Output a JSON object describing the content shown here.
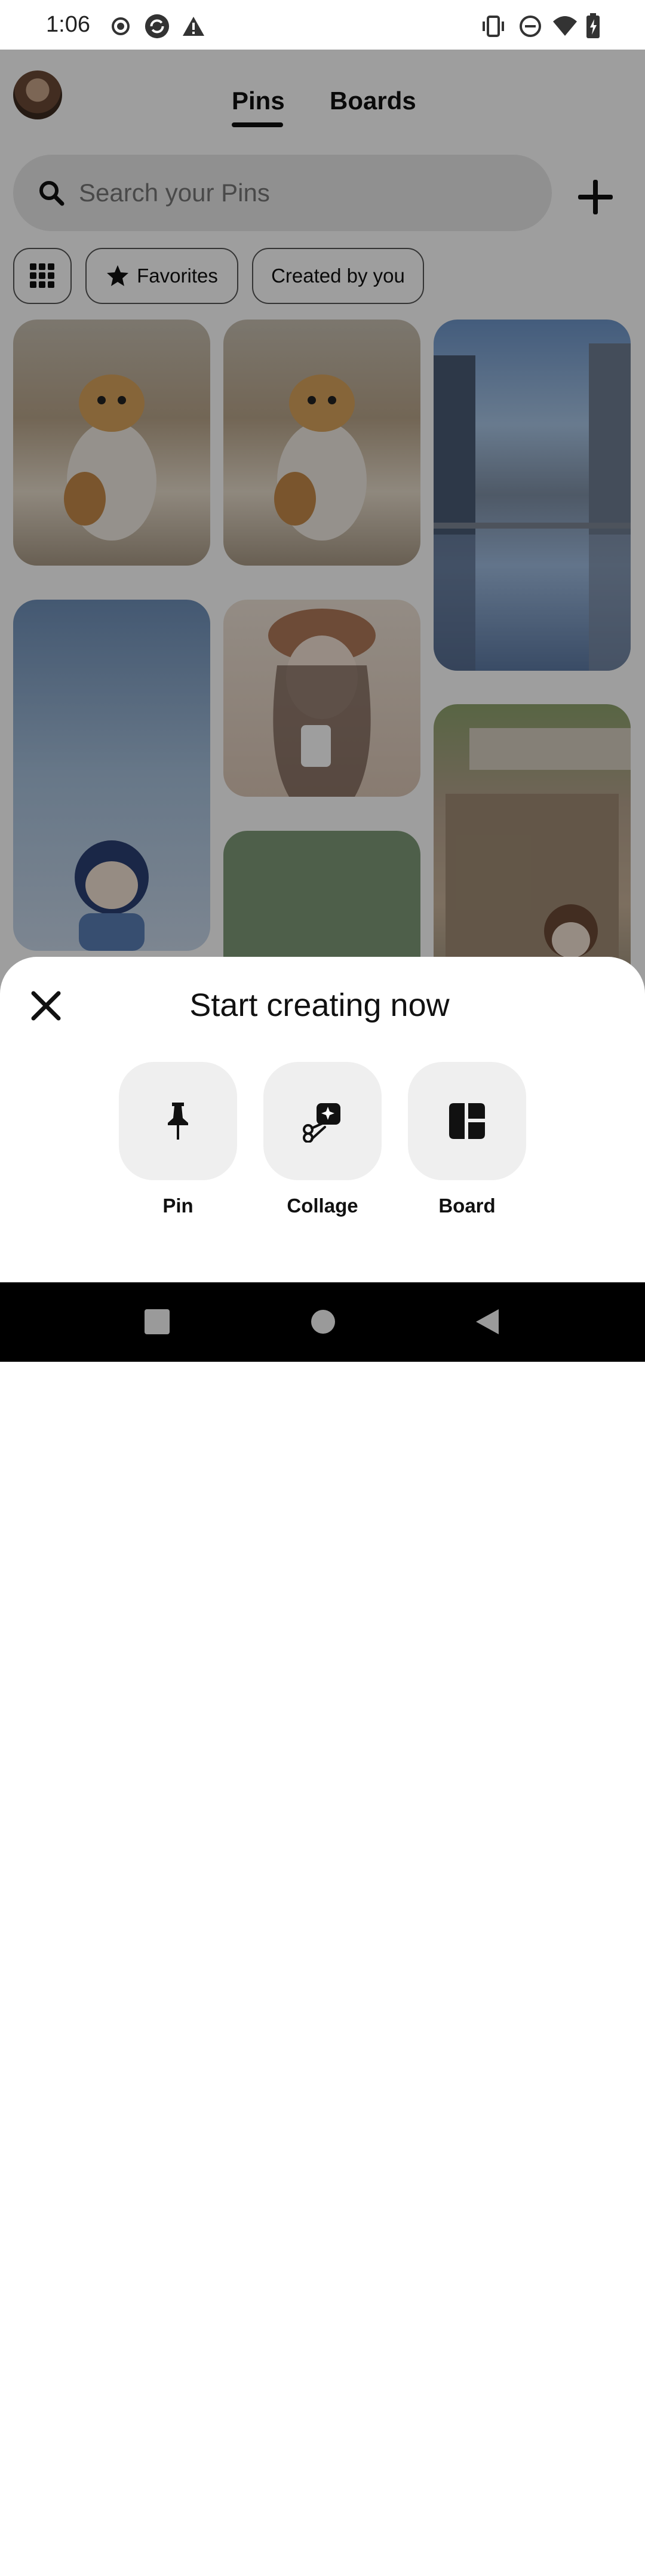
{
  "status_bar": {
    "time": "1:06",
    "left_icons": [
      "record-icon",
      "sync-icon",
      "warning-icon"
    ],
    "right_icons": [
      "vibrate-icon",
      "do-not-disturb-icon",
      "wifi-icon",
      "battery-charging-icon"
    ]
  },
  "header": {
    "tabs": [
      {
        "label": "Pins",
        "active": true
      },
      {
        "label": "Boards",
        "active": false
      }
    ]
  },
  "search": {
    "placeholder": "Search your Pins"
  },
  "filters": {
    "favorites_label": "Favorites",
    "created_label": "Created by you"
  },
  "pins": [
    {
      "name": "kitten-pin-1",
      "color": "#8a7a66"
    },
    {
      "name": "kitten-pin-2",
      "color": "#8a7a66"
    },
    {
      "name": "street-reflection-pin",
      "color": "#5f7fa6"
    },
    {
      "name": "chibi-girl-pin",
      "color": "#a7c1dc"
    },
    {
      "name": "girl-with-drink-pin",
      "color": "#dcc7b6"
    },
    {
      "name": "green-pin",
      "color": "#7e9a78"
    },
    {
      "name": "shop-front-pin",
      "color": "#9a8f7a"
    }
  ],
  "sheet": {
    "title": "Start creating now",
    "options": [
      {
        "label": "Pin",
        "icon": "pushpin-icon"
      },
      {
        "label": "Collage",
        "icon": "scissors-sparkle-icon"
      },
      {
        "label": "Board",
        "icon": "board-layout-icon"
      }
    ]
  },
  "nav": {
    "buttons": [
      "recents-icon",
      "home-icon",
      "back-icon"
    ]
  },
  "colors": {
    "overlay": "#000000",
    "sheet": "#ffffff",
    "option_bg": "#efefef"
  }
}
